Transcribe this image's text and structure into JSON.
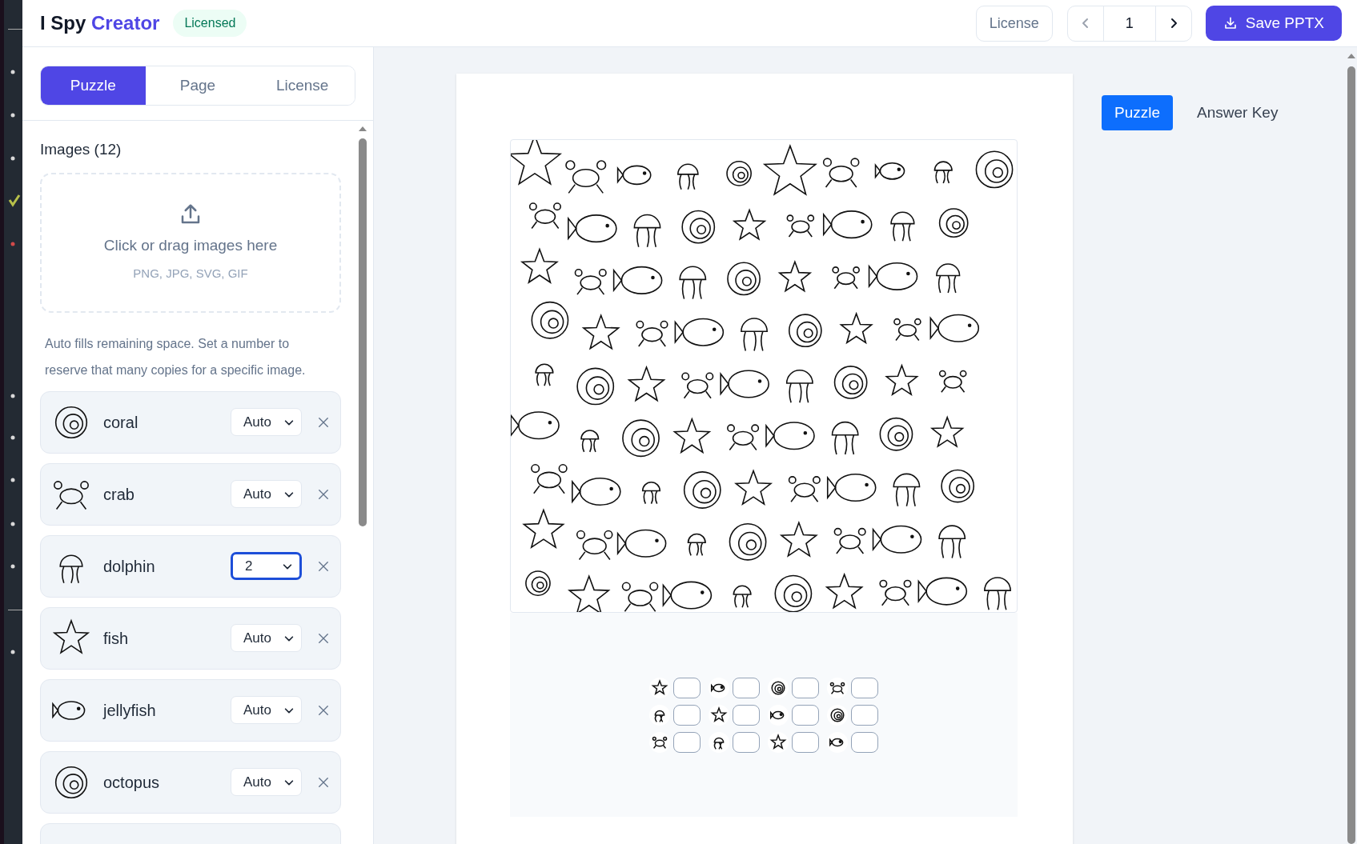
{
  "header": {
    "title_plain": "I Spy",
    "title_accent": "Creator",
    "badge": "Licensed",
    "license_button": "License",
    "pager": {
      "page": "1",
      "prev_disabled": true
    },
    "save_button": "Save PPTX"
  },
  "sidebar": {
    "tabs": [
      {
        "label": "Puzzle",
        "selected": true
      },
      {
        "label": "Page",
        "selected": false
      },
      {
        "label": "License",
        "selected": false
      }
    ],
    "images_heading": "Images (12)",
    "dropzone": {
      "text": "Click or drag images here",
      "formats": "PNG, JPG, SVG, GIF"
    },
    "help_text": "Auto fills remaining space. Set a number to reserve that many copies for a specific image.",
    "items": [
      {
        "name": "coral",
        "count": "Auto",
        "focused": false
      },
      {
        "name": "crab",
        "count": "Auto",
        "focused": false
      },
      {
        "name": "dolphin",
        "count": "2",
        "focused": true
      },
      {
        "name": "fish",
        "count": "Auto",
        "focused": false
      },
      {
        "name": "jellyfish",
        "count": "Auto",
        "focused": false
      },
      {
        "name": "octopus",
        "count": "Auto",
        "focused": false
      }
    ]
  },
  "preview": {
    "tabs": [
      {
        "label": "Puzzle",
        "selected": true
      },
      {
        "label": "Answer Key",
        "selected": false
      }
    ]
  }
}
